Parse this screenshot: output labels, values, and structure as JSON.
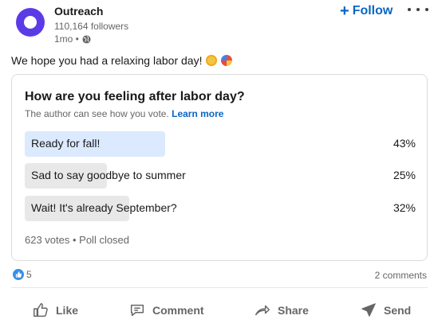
{
  "post": {
    "company": "Outreach",
    "followers": "110,164 followers",
    "time": "1mo •",
    "follow_label": "Follow",
    "follow_plus": "+",
    "text": "We hope you had a relaxing labor day!"
  },
  "poll": {
    "question": "How are you feeling after labor day?",
    "note": "The author can see how you vote.",
    "learn_more": "Learn more",
    "options": [
      {
        "label": "Ready for fall!",
        "percent": "43%",
        "fill": 0.43,
        "color": "#dbeafe"
      },
      {
        "label": "Sad to say goodbye to summer",
        "percent": "25%",
        "fill": 0.25,
        "color": "#e8e8e8"
      },
      {
        "label": "Wait! It's already September?",
        "percent": "32%",
        "fill": 0.32,
        "color": "#e8e8e8"
      }
    ],
    "footer": "623 votes • Poll closed"
  },
  "social": {
    "reaction_count": "5",
    "comments": "2 comments"
  },
  "actions": {
    "like": "Like",
    "comment": "Comment",
    "share": "Share",
    "send": "Send"
  },
  "colors": {
    "accent": "#0a66c2",
    "brand": "#5b3be6",
    "winning_bar": "#dbeafe",
    "other_bar": "#e8e8e8"
  },
  "icons": [
    "outreach-logo",
    "globe-icon",
    "sun-emoji",
    "beach-ball-emoji",
    "like-reaction-icon",
    "like-icon",
    "comment-icon",
    "share-icon",
    "send-icon",
    "more-icon"
  ]
}
